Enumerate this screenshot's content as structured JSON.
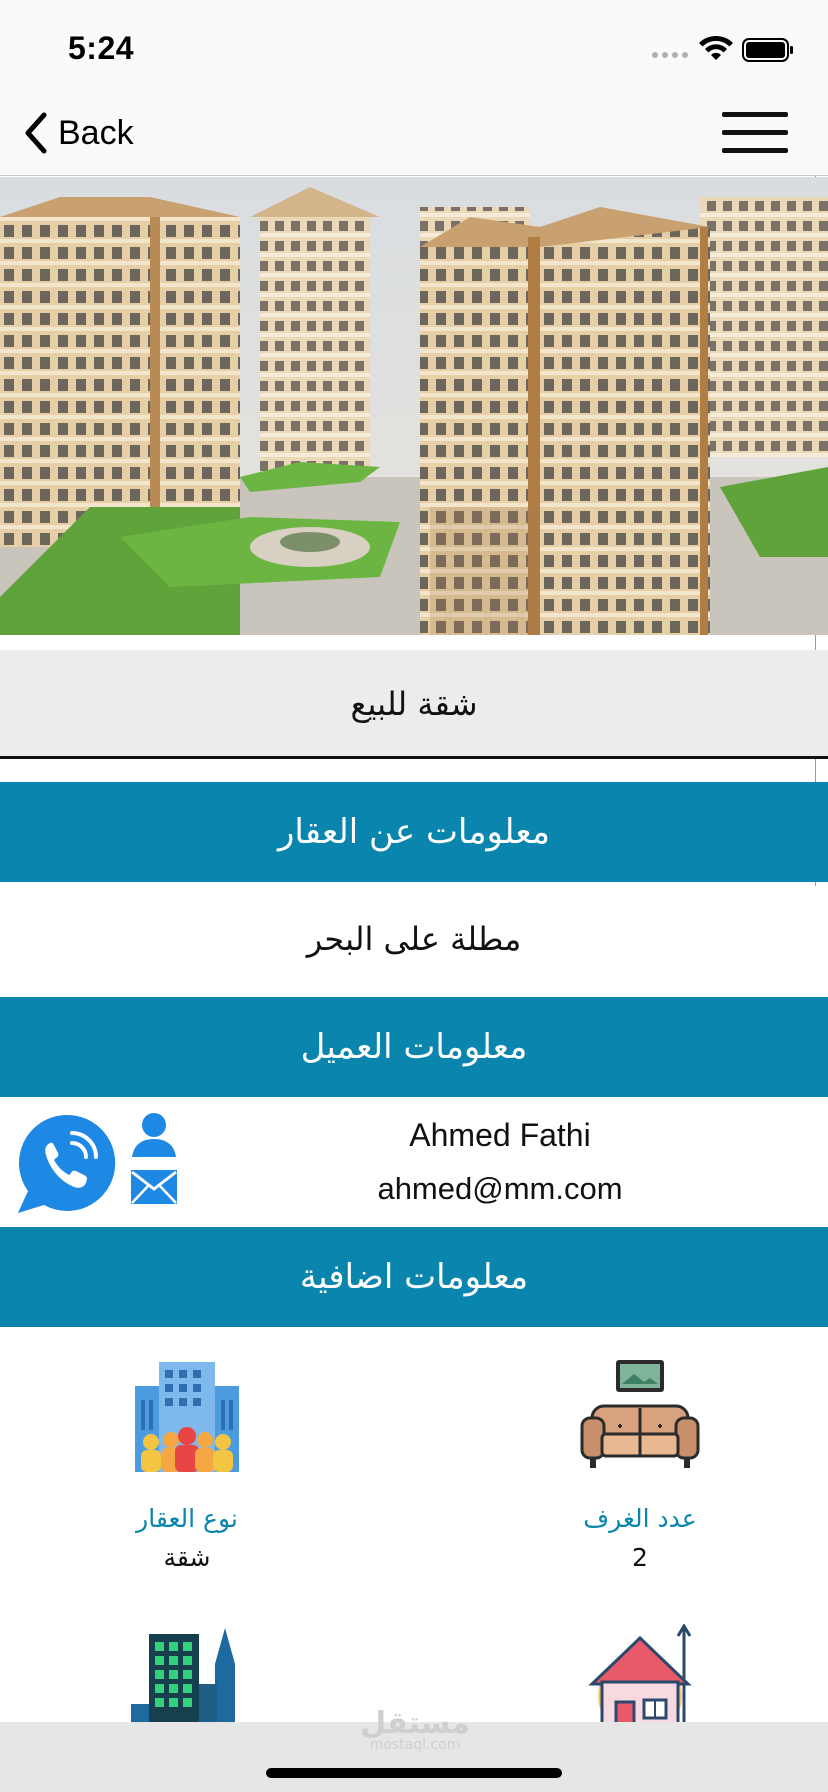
{
  "status_bar": {
    "time": "5:24"
  },
  "nav": {
    "back_label": "Back"
  },
  "listing": {
    "title": "شقة للبيع",
    "property_section_title": "معلومات عن العقار",
    "property_description": "مطلة على البحر"
  },
  "client": {
    "section_title": "معلومات العميل",
    "name": "Ahmed Fathi",
    "email": "ahmed@mm.com"
  },
  "extra": {
    "section_title": "معلومات اضافية",
    "features": [
      {
        "label": "عدد الغرف",
        "value": "2",
        "icon": "sofa-icon"
      },
      {
        "label": "نوع العقار",
        "value": "شقة",
        "icon": "building-type-icon"
      },
      {
        "icon": "house-price-icon"
      },
      {
        "icon": "skyscraper-icon"
      }
    ]
  },
  "watermark": {
    "arabic": "مستقل",
    "latin": "mostaql.com"
  },
  "colors": {
    "accent": "#0a85ad",
    "call_button": "#1e88e5"
  }
}
